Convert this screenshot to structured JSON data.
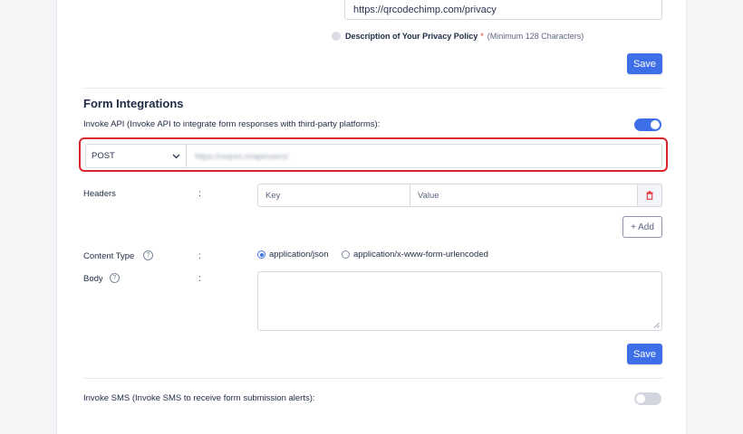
{
  "privacy": {
    "url_value": "https://qrcodechimp.com/privacy",
    "description_label": "Description of Your Privacy Policy",
    "required_mark": "*",
    "description_hint": "(Minimum 128 Characters)",
    "save_label": "Save"
  },
  "form_integrations": {
    "heading": "Form Integrations",
    "invoke_api_label": "Invoke API (Invoke API to integrate form responses with third-party platforms):",
    "invoke_api_enabled": true,
    "method_value": "POST",
    "endpoint_value": "https://reqres.in/api/users/",
    "headers_label": "Headers",
    "colon": ":",
    "header_key_placeholder": "Key",
    "header_value_placeholder": "Value",
    "add_label": "+ Add",
    "content_type_label": "Content Type",
    "content_type_options": [
      "application/json",
      "application/x-www-form-urlencoded"
    ],
    "content_type_selected": "application/json",
    "body_label": "Body",
    "save_label": "Save",
    "invoke_sms_label": "Invoke SMS (Invoke SMS to receive form submission alerts):",
    "invoke_sms_enabled": false
  },
  "colors": {
    "accent": "#3f6fe8",
    "highlight": "#d9262b",
    "delete": "#e0343a"
  }
}
